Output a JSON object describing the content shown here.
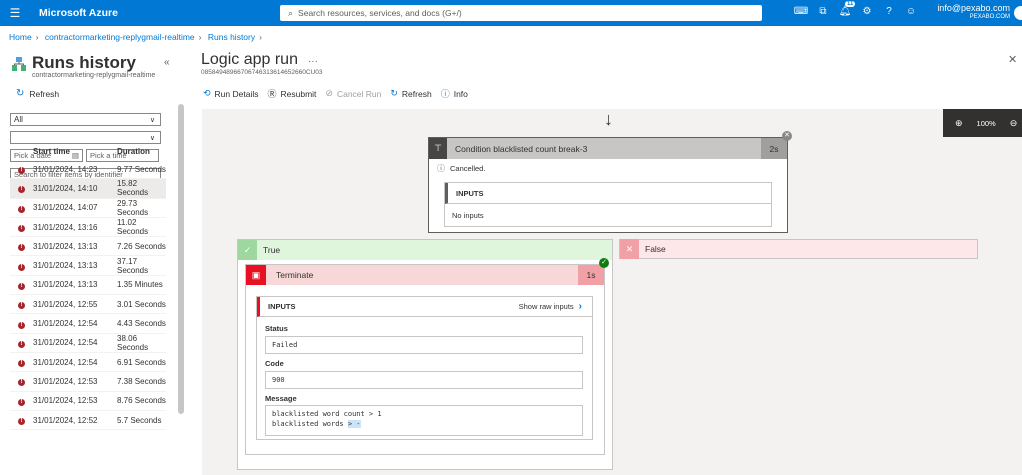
{
  "topbar": {
    "brand": "Microsoft Azure",
    "search_placeholder": "Search resources, services, and docs (G+/)",
    "notification_count": "11",
    "account_email": "info@pexabo.com",
    "account_org": "PEXABO.COM",
    "colors": {
      "bar": "#0078d4"
    }
  },
  "breadcrumb": [
    "Home",
    "contractormarketing-replygmail-realtime",
    "Runs history"
  ],
  "left": {
    "title": "Runs history",
    "subtitle": "contractormarketing-replygmail-realtime",
    "refresh": "Refresh",
    "status_filter": "All",
    "second_filter": "",
    "date_placeholder": "Pick a date",
    "time_placeholder": "Pick a time",
    "search_placeholder": "Search to filter items by identifier",
    "columns": [
      "Start time",
      "Duration"
    ],
    "runs": [
      {
        "start": "31/01/2024, 14:23",
        "duration": "9.77 Seconds"
      },
      {
        "start": "31/01/2024, 14:10",
        "duration": "15.82 Seconds"
      },
      {
        "start": "31/01/2024, 14:07",
        "duration": "29.73 Seconds"
      },
      {
        "start": "31/01/2024, 13:16",
        "duration": "11.02 Seconds"
      },
      {
        "start": "31/01/2024, 13:13",
        "duration": "7.26 Seconds"
      },
      {
        "start": "31/01/2024, 13:13",
        "duration": "37.17 Seconds"
      },
      {
        "start": "31/01/2024, 13:13",
        "duration": "1.35 Minutes"
      },
      {
        "start": "31/01/2024, 12:55",
        "duration": "3.01 Seconds"
      },
      {
        "start": "31/01/2024, 12:54",
        "duration": "4.43 Seconds"
      },
      {
        "start": "31/01/2024, 12:54",
        "duration": "38.06 Seconds"
      },
      {
        "start": "31/01/2024, 12:54",
        "duration": "6.91 Seconds"
      },
      {
        "start": "31/01/2024, 12:53",
        "duration": "7.38 Seconds"
      },
      {
        "start": "31/01/2024, 12:53",
        "duration": "8.76 Seconds"
      },
      {
        "start": "31/01/2024, 12:52",
        "duration": "5.7 Seconds"
      }
    ],
    "selected_index": 1
  },
  "main": {
    "title": "Logic app run",
    "run_id": "08584948966706746313614652660CU03",
    "toolbar": {
      "run_details": "Run Details",
      "resubmit": "Resubmit",
      "cancel_run": "Cancel Run",
      "refresh": "Refresh",
      "info": "Info"
    },
    "zoom": "100%"
  },
  "condition": {
    "title": "Condition blacklisted count break-3",
    "duration": "2s",
    "status": "Cancelled.",
    "inputs_label": "INPUTS",
    "inputs_value": "No inputs"
  },
  "branches": {
    "true_label": "True",
    "false_label": "False"
  },
  "terminate": {
    "title": "Terminate",
    "duration": "1s",
    "inputs_label": "INPUTS",
    "show_raw": "Show raw inputs",
    "status_label": "Status",
    "status_value": "Failed",
    "code_label": "Code",
    "code_value": "900",
    "message_label": "Message",
    "message_line1": "blacklisted word count > 1",
    "message_line2_prefix": "blacklisted words ",
    "message_line2_sel": "> -"
  }
}
